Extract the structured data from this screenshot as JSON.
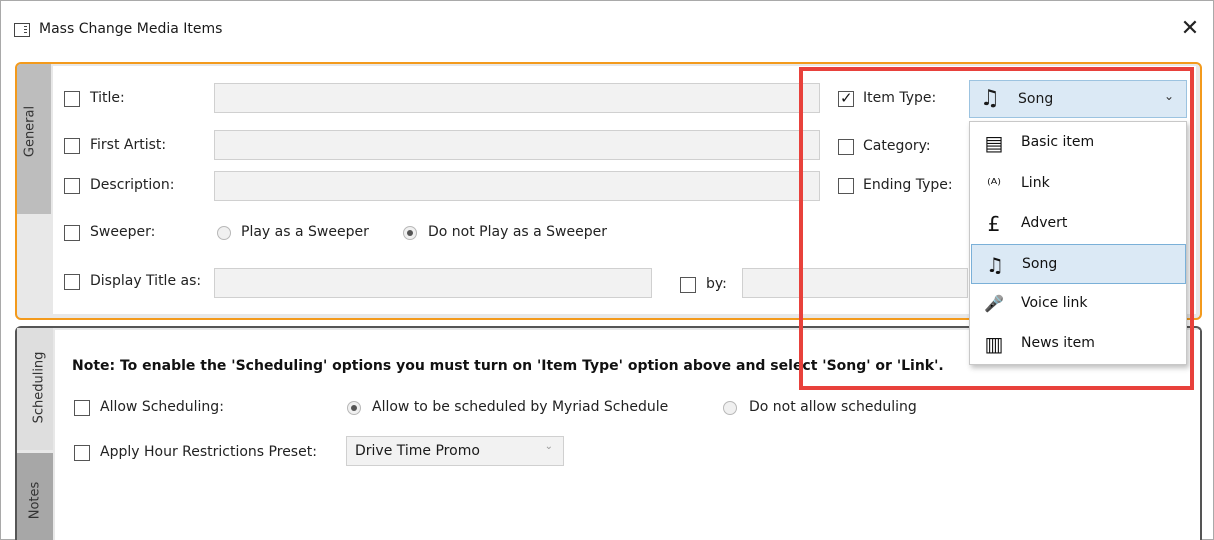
{
  "window": {
    "title": "Mass Change Media Items",
    "close": "✕"
  },
  "general": {
    "tab_label": "General",
    "title_label": "Title:",
    "first_artist_label": "First Artist:",
    "description_label": "Description:",
    "sweeper_label": "Sweeper:",
    "sweeper_opt_play": "Play as a Sweeper",
    "sweeper_opt_no": "Do not Play as a Sweeper",
    "display_title_label": "Display Title as:",
    "by_label": "by:",
    "item_type_label": "Item Type:",
    "item_type_checked": true,
    "category_label": "Category:",
    "ending_type_label": "Ending Type:"
  },
  "item_type_combo": {
    "selected": "Song",
    "selected_icon": "music-note-icon",
    "chevron": "⌄"
  },
  "item_type_options": [
    {
      "label": "Basic item",
      "icon": "basic-item-icon",
      "glyph": "▤"
    },
    {
      "label": "Link",
      "icon": "broadcast-link-icon",
      "glyph": "⁽ᴬ⁾"
    },
    {
      "label": "Advert",
      "icon": "pound-sign-icon",
      "glyph": "£"
    },
    {
      "label": "Song",
      "icon": "music-note-icon",
      "glyph": "♫",
      "selected": true
    },
    {
      "label": "Voice link",
      "icon": "microphone-icon",
      "glyph": "🎤"
    },
    {
      "label": "News item",
      "icon": "newspaper-icon",
      "glyph": "▥"
    }
  ],
  "scheduling": {
    "tab_label": "Scheduling",
    "notes_tab_label": "Notes",
    "note": "Note: To enable the 'Scheduling' options you must turn on 'Item Type' option above and select 'Song' or 'Link'.",
    "allow_label": "Allow Scheduling:",
    "allow_opt_yes": "Allow to be scheduled by Myriad Schedule",
    "allow_opt_no": "Do not allow scheduling",
    "hour_restr_label": "Apply Hour Restrictions Preset:",
    "hour_restr_value": "Drive Time Promo"
  },
  "colors": {
    "accent_orange": "#f39a1c",
    "highlight_red": "#e8413b",
    "selection_blue": "#dbe9f5"
  }
}
